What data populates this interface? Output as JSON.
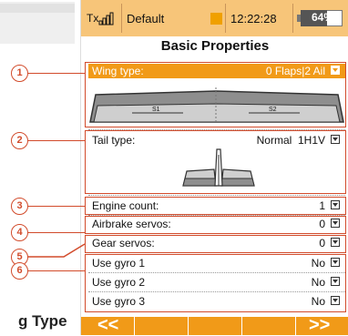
{
  "status": {
    "signal_label": "Tx",
    "profile": "Default",
    "time": "12:22:28",
    "battery": "64%",
    "battery_level": 0.64
  },
  "page": {
    "title": "Basic Properties"
  },
  "wing": {
    "label": "Wing type:",
    "value": "0 Flaps|2 Ail",
    "servo1": "S1",
    "servo2": "S2"
  },
  "tail": {
    "label": "Tail type:",
    "value": "Normal  1H1V"
  },
  "rows": {
    "engine": {
      "label": "Engine count:",
      "value": "1"
    },
    "airbrake": {
      "label": "Airbrake servos:",
      "value": "0"
    },
    "gear": {
      "label": "Gear servos:",
      "value": "0"
    },
    "gyro1": {
      "label": "Use gyro 1",
      "value": "No"
    },
    "gyro2": {
      "label": "Use gyro 2",
      "value": "No"
    },
    "gyro3": {
      "label": "Use gyro 3",
      "value": "No"
    }
  },
  "nav": {
    "prev": "<<",
    "next": ">>"
  },
  "callouts": [
    "1",
    "2",
    "3",
    "4",
    "5",
    "6"
  ],
  "bottom_text": "g Type",
  "colors": {
    "accent": "#f19a18",
    "status_bar": "#f7c579",
    "callout": "#d24b2b"
  }
}
